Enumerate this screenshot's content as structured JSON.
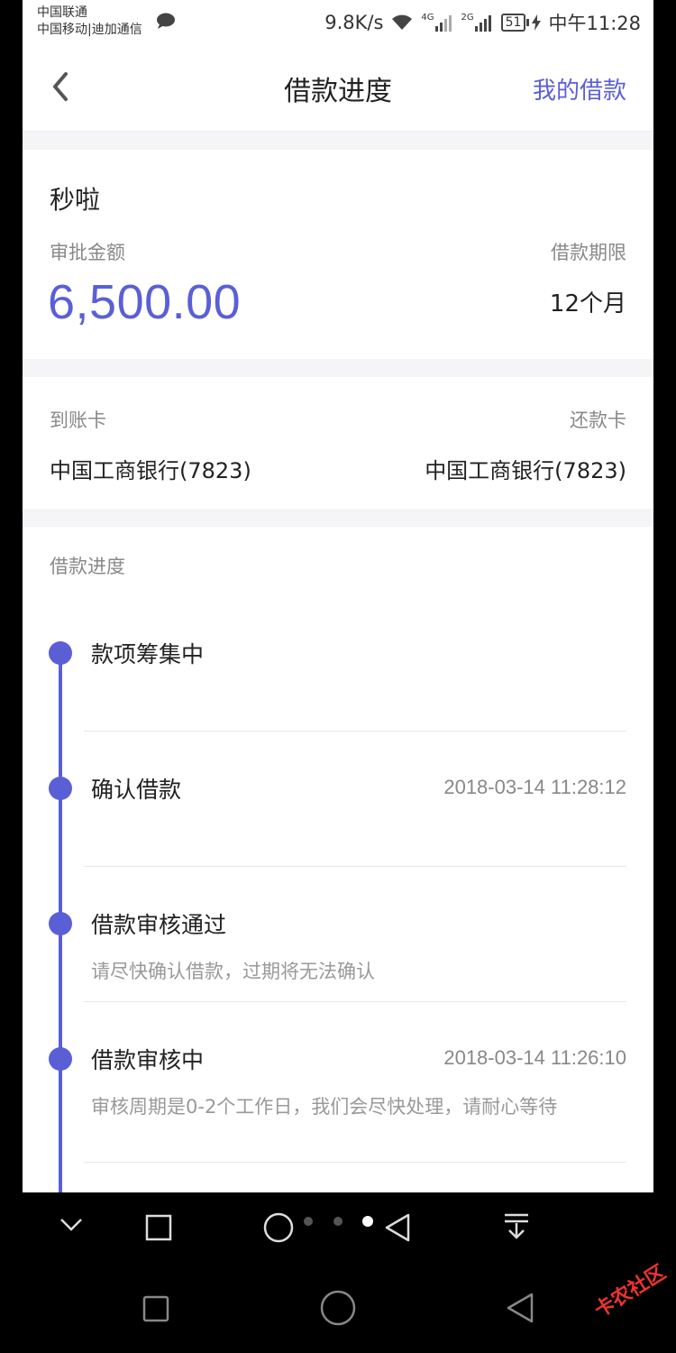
{
  "status_bar": {
    "carrier1": "中国联通",
    "carrier2": "中国移动|迪加通信",
    "speed": "9.8K/s",
    "net1": "4G",
    "net2": "2G",
    "battery": "51",
    "time": "中午11:28"
  },
  "nav": {
    "title": "借款进度",
    "right_link": "我的借款"
  },
  "loan": {
    "product": "秒啦",
    "amount_label": "审批金额",
    "amount": "6,500.00",
    "term_label": "借款期限",
    "term": "12个月"
  },
  "cards": {
    "receive_label": "到账卡",
    "receive_value": "中国工商银行(7823)",
    "repay_label": "还款卡",
    "repay_value": "中国工商银行(7823)"
  },
  "progress": {
    "section_label": "借款进度",
    "steps": [
      {
        "title": "款项筹集中",
        "time": "",
        "desc": ""
      },
      {
        "title": "确认借款",
        "time": "2018-03-14 11:28:12",
        "desc": ""
      },
      {
        "title": "借款审核通过",
        "time": "",
        "desc": "请尽快确认借款，过期将无法确认"
      },
      {
        "title": "借款审核中",
        "time": "2018-03-14 11:26:10",
        "desc": "审核周期是0-2个工作日，我们会尽快处理，请耐心等待"
      }
    ]
  },
  "watermark": "卡农社区",
  "colors": {
    "accent": "#5a5fd6"
  }
}
